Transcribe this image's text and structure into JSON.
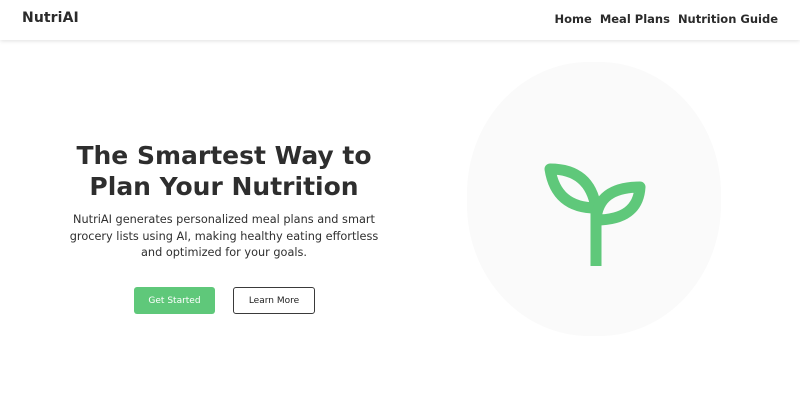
{
  "header": {
    "brand": "NutriAI",
    "nav": [
      {
        "label": "Home"
      },
      {
        "label": "Meal Plans"
      },
      {
        "label": "Nutrition Guide"
      }
    ]
  },
  "hero": {
    "title_line1": "The Smartest Way to",
    "title_line2": "Plan Your Nutrition",
    "description": "NutriAI generates personalized meal plans and smart grocery lists using AI, making healthy eating effortless and optimized for your goals.",
    "primary_cta": "Get Started",
    "secondary_cta": "Learn More",
    "illustration_icon": "sprout-icon"
  },
  "colors": {
    "accent": "#5fc87a",
    "text": "#2b2b2b",
    "illustration_bg": "#fafafa"
  }
}
